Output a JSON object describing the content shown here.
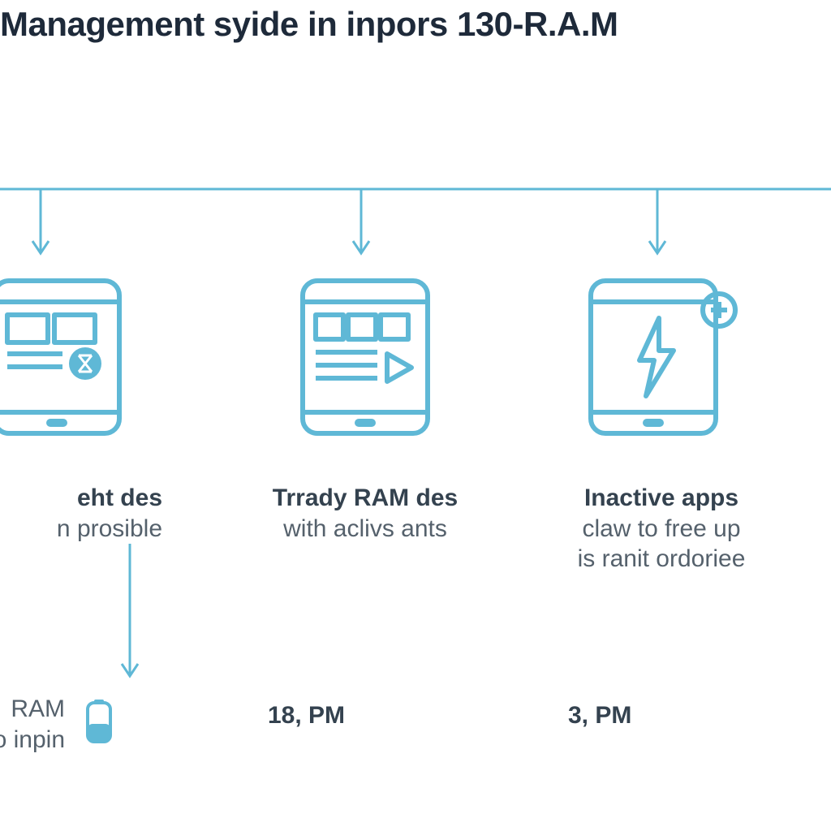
{
  "title": "Management syide in inpors 130-R.A.M",
  "colors": {
    "accent": "#5fb8d6",
    "heading": "#1e2a3a",
    "text_dark": "#34424f",
    "text_light": "#55616c"
  },
  "columns": [
    {
      "icon": "phone-blocked-icon",
      "title": "eht des",
      "subtitle": "n prosible",
      "value": "RAM",
      "value_sub": "o inpin"
    },
    {
      "icon": "phone-play-icon",
      "title": "Trrady RAM des",
      "subtitle": "with aclivs ants",
      "value": "18, PM"
    },
    {
      "icon": "phone-bolt-icon",
      "title": "Inactive apps",
      "subtitle": "claw to free up\nis ranit ordoriee",
      "value": "3, PM"
    }
  ],
  "mini_icon": "device-mini-icon"
}
